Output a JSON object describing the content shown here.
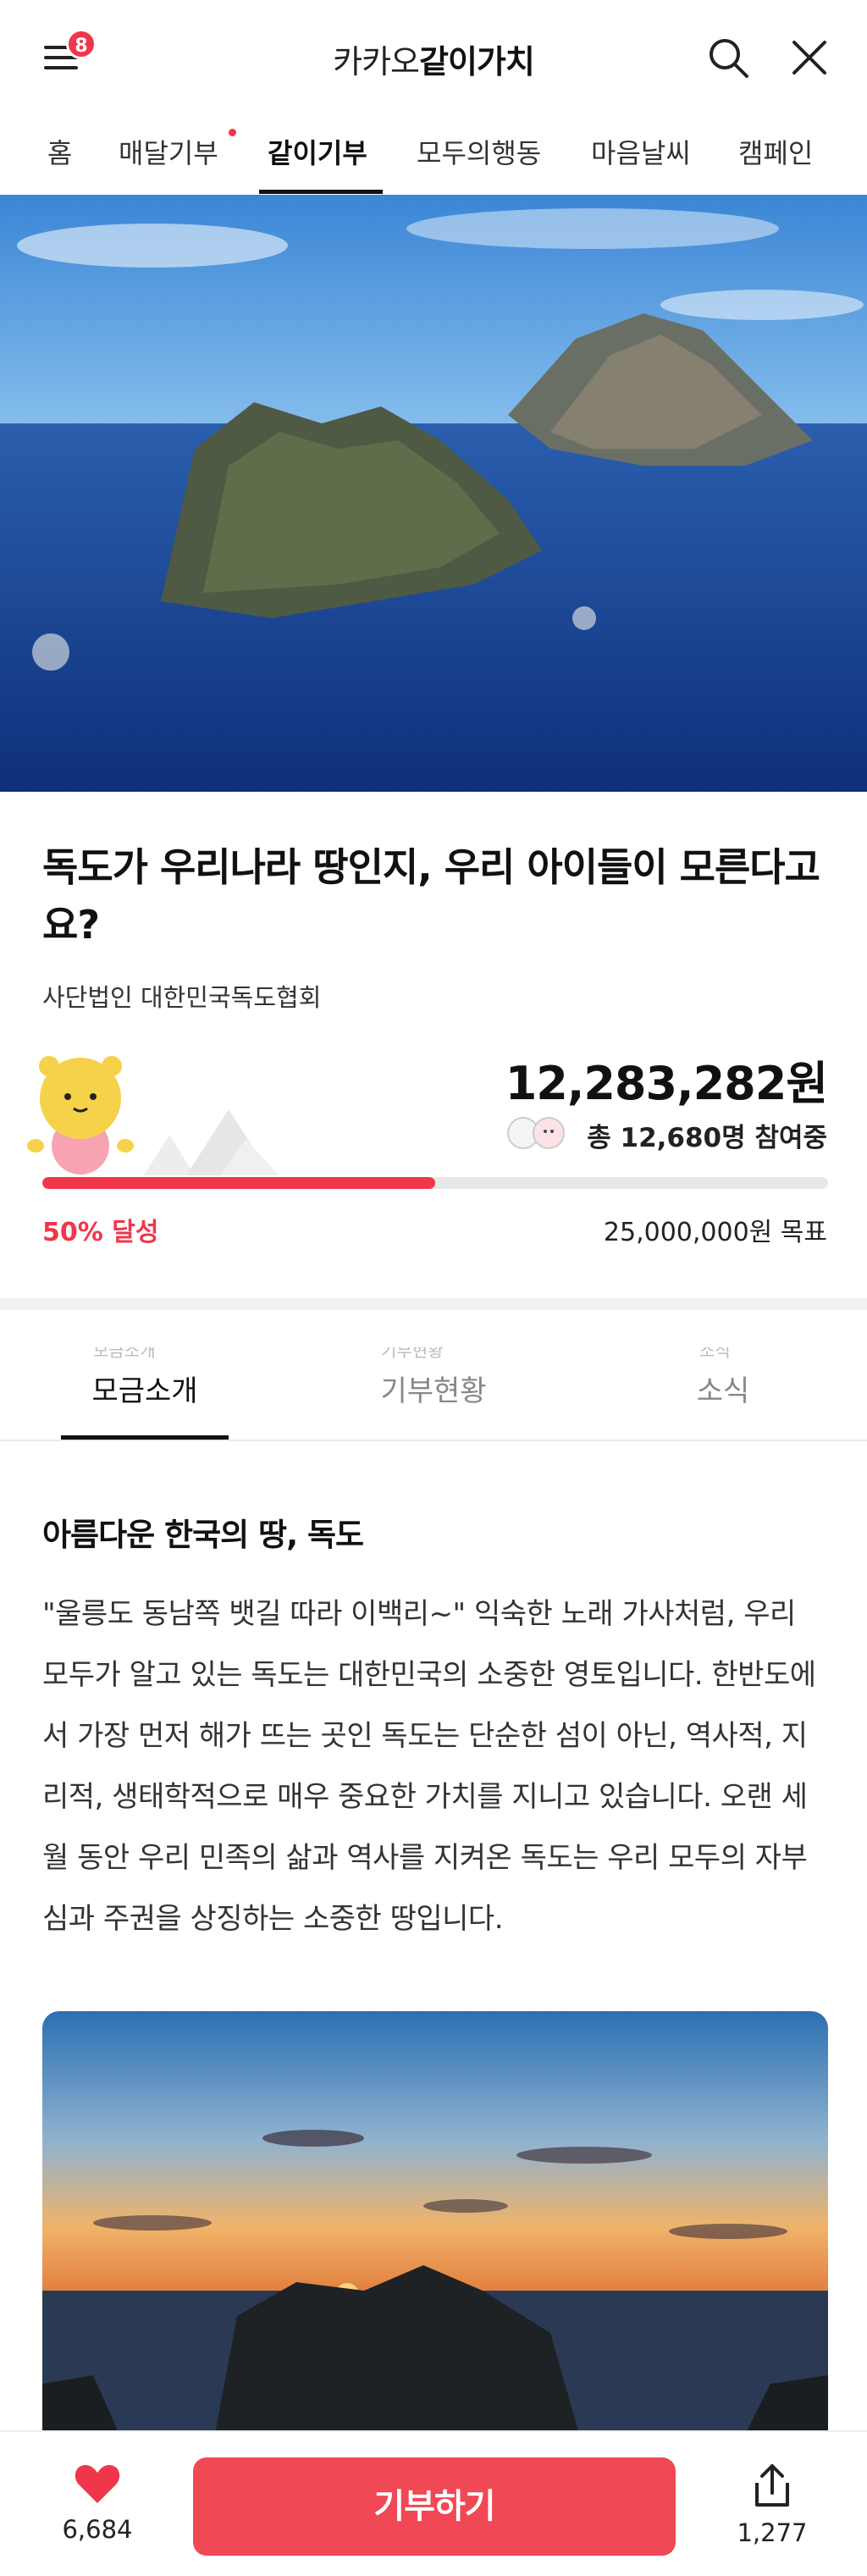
{
  "header": {
    "brand_light": "카카오",
    "brand_bold": "같이가치",
    "notification_count": "8",
    "accent_color": "#f0364b"
  },
  "nav": {
    "items": [
      {
        "label": "홈"
      },
      {
        "label": "매달기부"
      },
      {
        "label": "같이기부",
        "active": true
      },
      {
        "label": "모두의행동"
      },
      {
        "label": "마음날씨"
      },
      {
        "label": "캠페인"
      }
    ]
  },
  "campaign": {
    "title": "독도가 우리나라 땅인지, 우리 아이들이 모른다고요?",
    "organization": "사단법인 대한민국독도협회",
    "amount": "12,283,282원",
    "participants": "총 12,680명 참여중",
    "progress_percent": 50,
    "achieved_label": "50% 달성",
    "goal_label": "25,000,000원 목표"
  },
  "content_tabs": {
    "items": [
      {
        "label": "모금소개",
        "active": true
      },
      {
        "label": "기부현황"
      },
      {
        "label": "소식"
      }
    ]
  },
  "article": {
    "section_title": "아름다운 한국의 땅, 독도",
    "paragraph": "\"울릉도 동남쪽 뱃길 따라 이백리~\" 익숙한 노래 가사처럼, 우리 모두가 알고 있는 독도는 대한민국의 소중한 영토입니다. 한반도에서 가장 먼저 해가 뜨는 곳인 독도는 단순한 섬이 아닌, 역사적, 지리적, 생태학적으로 매우 중요한 가치를 지니고 있습니다. 오랜 세월 동안 우리 민족의 삶과 역사를 지켜온 독도는 우리 모두의 자부심과 주권을 상징하는 소중한 땅입니다."
  },
  "bottom_bar": {
    "like_count": "6,684",
    "donate_label": "기부하기",
    "share_count": "1,277",
    "button_color": "#f04854"
  }
}
